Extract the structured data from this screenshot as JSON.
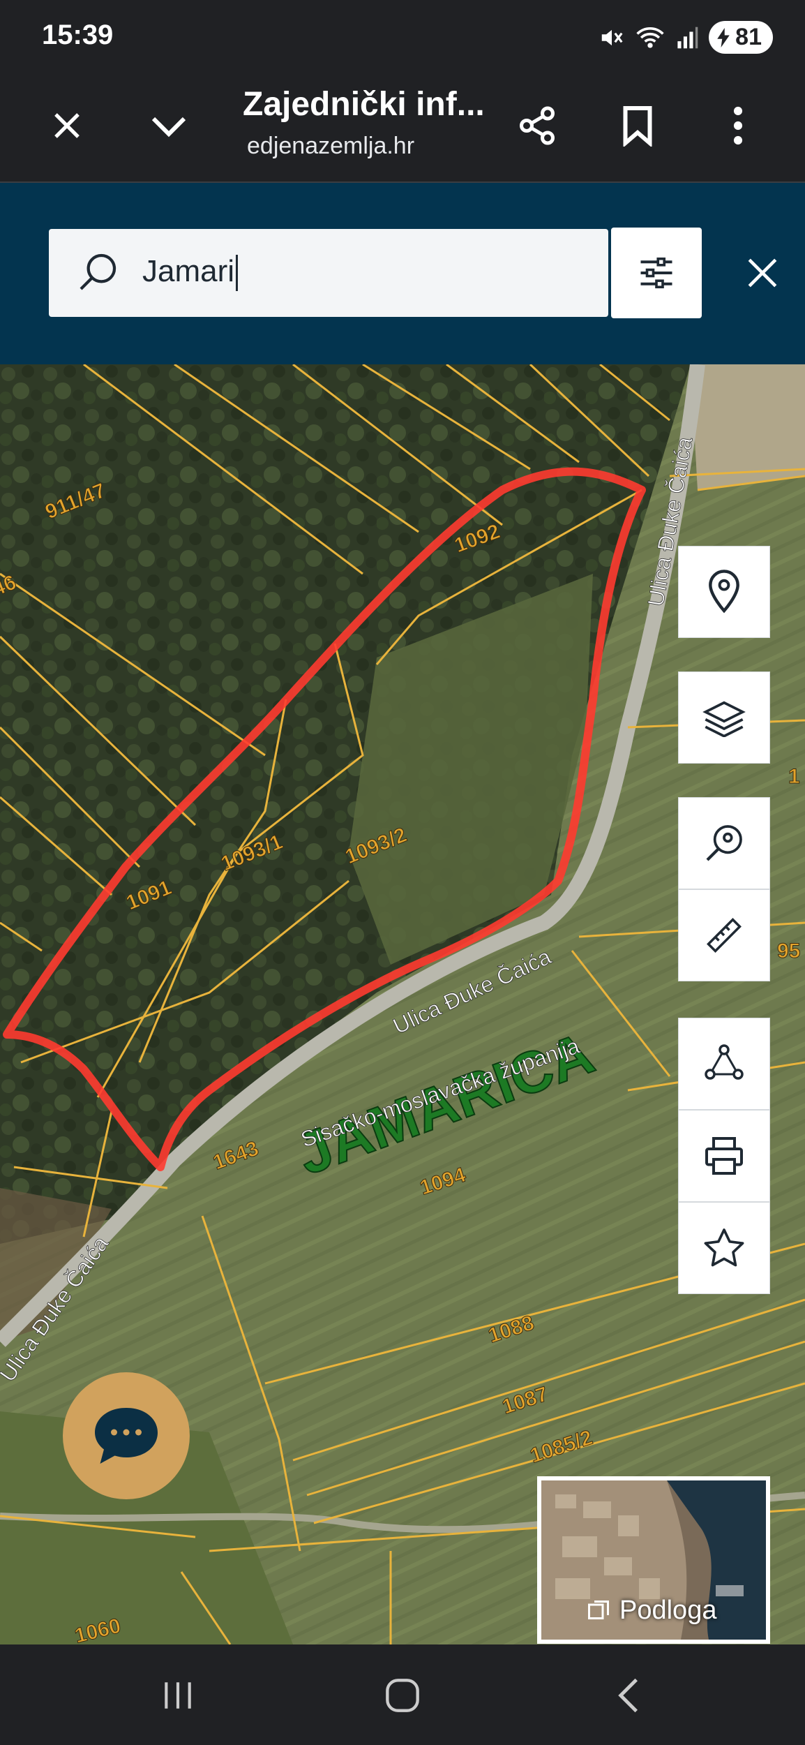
{
  "status_bar": {
    "time": "15:39",
    "battery": "81",
    "icons": [
      "mute-icon",
      "wifi-icon",
      "signal-icon",
      "battery-icon"
    ]
  },
  "browser": {
    "title": "Zajednički inf...",
    "url": "edjenazemlja.hr",
    "icons": [
      "close-icon",
      "chevron-down-icon",
      "share-icon",
      "bookmark-icon",
      "more-icon"
    ]
  },
  "search": {
    "value": "Jamari",
    "icons": [
      "search-icon",
      "filter-icon",
      "close-icon"
    ]
  },
  "map": {
    "parcel_labels": [
      "911/47",
      "46",
      "1092",
      "1093/2",
      "1093/1",
      "1091",
      "1643",
      "1094",
      "1088",
      "1087",
      "1085/2",
      "1060",
      "95",
      "1"
    ],
    "street_labels": [
      "Ulica Đuke Čaića",
      "Ulica Đuke Čaića",
      "Ulica Đuke Čaića"
    ],
    "region_label": "Sisačko-moslavačka županija",
    "place_label": "JAMARICA",
    "colors": {
      "parcel": "#e8b33c",
      "highlight": "#ff3b30",
      "place": "#1d7a24"
    }
  },
  "toolbar": {
    "tools": [
      "location-icon",
      "layers-icon",
      "search-location-icon",
      "ruler-icon",
      "polygon-icon",
      "print-icon",
      "star-icon"
    ]
  },
  "basemap": {
    "label": "Podloga"
  },
  "nav": {
    "icons": [
      "recent-apps-icon",
      "home-icon",
      "back-icon"
    ]
  }
}
